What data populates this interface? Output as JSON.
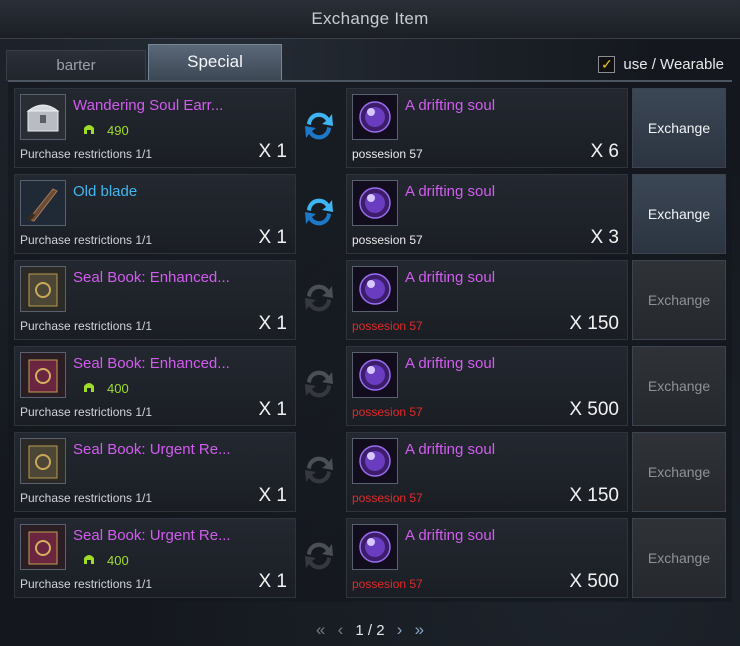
{
  "window": {
    "title": "Exchange Item"
  },
  "tabs": {
    "barter": "barter",
    "special": "Special"
  },
  "filter": {
    "label": "use / Wearable",
    "checked": true,
    "check_glyph": "✓"
  },
  "rows": [
    {
      "item_name": "Wandering Soul Earr...",
      "item_color": "purple",
      "icon": "chest-icon",
      "price": "490",
      "restriction": "Purchase restrictions 1/1",
      "item_qty": "X 1",
      "cost_name": "A drifting soul",
      "possession": "possesion 57",
      "possession_ok": true,
      "cost_qty": "X 6",
      "button": "Exchange",
      "enabled": true
    },
    {
      "item_name": "Old blade",
      "item_color": "blue",
      "icon": "blade-icon",
      "price": "",
      "restriction": "Purchase restrictions 1/1",
      "item_qty": "X 1",
      "cost_name": "A drifting soul",
      "possession": "possesion 57",
      "possession_ok": true,
      "cost_qty": "X 3",
      "button": "Exchange",
      "enabled": true
    },
    {
      "item_name": "Seal Book: Enhanced...",
      "item_color": "purple",
      "icon": "book-gold-icon",
      "price": "",
      "restriction": "Purchase restrictions 1/1",
      "item_qty": "X 1",
      "cost_name": "A drifting soul",
      "possession": "possesion 57",
      "possession_ok": false,
      "cost_qty": "X 150",
      "button": "Exchange",
      "enabled": false
    },
    {
      "item_name": "Seal Book: Enhanced...",
      "item_color": "purple",
      "icon": "book-red-icon",
      "price": "400",
      "restriction": "Purchase restrictions 1/1",
      "item_qty": "X 1",
      "cost_name": "A drifting soul",
      "possession": "possesion 57",
      "possession_ok": false,
      "cost_qty": "X 500",
      "button": "Exchange",
      "enabled": false
    },
    {
      "item_name": "Seal Book: Urgent Re...",
      "item_color": "purple",
      "icon": "book-gold-icon",
      "price": "",
      "restriction": "Purchase restrictions 1/1",
      "item_qty": "X 1",
      "cost_name": "A drifting soul",
      "possession": "possesion 57",
      "possession_ok": false,
      "cost_qty": "X 150",
      "button": "Exchange",
      "enabled": false
    },
    {
      "item_name": "Seal Book: Urgent Re...",
      "item_color": "purple",
      "icon": "book-red-icon",
      "price": "400",
      "restriction": "Purchase restrictions 1/1",
      "item_qty": "X 1",
      "cost_name": "A drifting soul",
      "possession": "possesion 57",
      "possession_ok": false,
      "cost_qty": "X 500",
      "button": "Exchange",
      "enabled": false
    }
  ],
  "pager": {
    "first": "«",
    "prev": "‹",
    "label": "1 / 2",
    "next": "›",
    "last": "»"
  },
  "colors": {
    "accent_purple": "#d35cf0",
    "accent_blue": "#42b6f0",
    "price_green": "#9fdc2a",
    "warn_red": "#e02a2a"
  }
}
